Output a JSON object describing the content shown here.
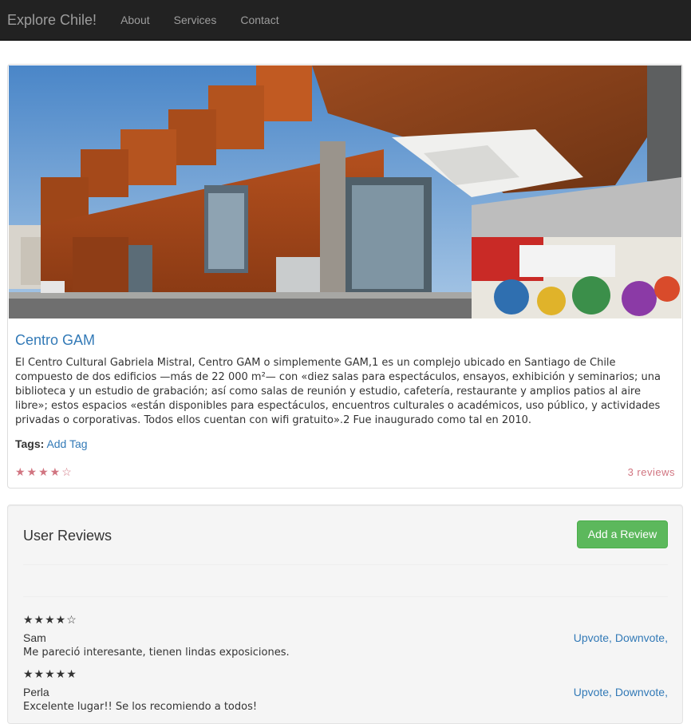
{
  "navbar": {
    "brand": "Explore Chile!",
    "links": [
      "About",
      "Services",
      "Contact"
    ]
  },
  "place": {
    "title": "Centro GAM",
    "description": "El Centro Cultural Gabriela Mistral, Centro GAM o simplemente GAM,1 es un complejo ubicado en Santiago de Chile compuesto de dos edificios —más de 22 000 m²— con «diez salas para espectáculos, ensayos, exhibición y seminarios; una biblioteca y un estudio de grabación; así como salas de reunión y estudio, cafetería, restaurante y amplios patios al aire libre»; estos espacios «están disponibles para espectáculos, encuentros culturales o académicos, uso público, y actividades privadas o corporativas. Todos ellos cuentan con wifi gratuito».2 Fue inaugurado como tal en 2010.",
    "tags_label": "Tags:",
    "add_tag": "Add Tag",
    "stars": "★★★★☆",
    "rating": 4,
    "rating_max": 5,
    "reviews_count": "3 reviews"
  },
  "reviews_panel": {
    "title": "User Reviews",
    "add_button": "Add a Review",
    "reviews": [
      {
        "stars": "★★★★☆",
        "rating": 4,
        "author": "Sam",
        "votes": "Upvote, Downvote,",
        "comment": "Me pareció interesante, tienen lindas exposiciones."
      },
      {
        "stars": "★★★★★",
        "rating": 5,
        "author": "Perla",
        "votes": "Upvote, Downvote,",
        "comment": "Excelente lugar!! Se los recomiendo a todos!"
      }
    ]
  },
  "colors": {
    "navbar_bg": "#222222",
    "link_blue": "#337ab7",
    "star_red": "#d17581",
    "button_green": "#5cb85c"
  }
}
